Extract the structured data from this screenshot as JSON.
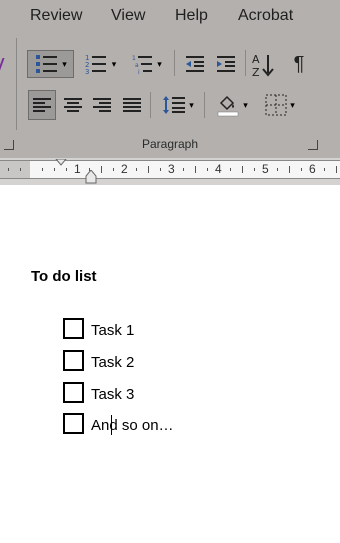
{
  "menu": {
    "items": [
      "Review",
      "View",
      "Help",
      "Acrobat"
    ]
  },
  "ribbon": {
    "group_label": "Paragraph",
    "buttons": {
      "bullets_icon": "bulleted-list-icon",
      "numbering_icon": "numbered-list-icon",
      "multilevel_icon": "multilevel-list-icon",
      "decrease_indent_icon": "decrease-indent-icon",
      "increase_indent_icon": "increase-indent-icon",
      "sort_icon": "sort-az-icon",
      "show_marks_icon": "pilcrow-icon",
      "align_left_icon": "align-left-icon",
      "center_icon": "align-center-icon",
      "align_right_icon": "align-right-icon",
      "justify_icon": "justify-icon",
      "line_spacing_icon": "line-spacing-icon",
      "shading_icon": "paint-bucket-icon",
      "borders_icon": "borders-icon"
    },
    "sort_label": "A Z",
    "pilcrow": "¶"
  },
  "ruler": {
    "numbers": [
      "1",
      "2",
      "3",
      "4",
      "5",
      "6"
    ]
  },
  "document": {
    "title": "To do list",
    "tasks": [
      "Task 1",
      "Task 2",
      "Task 3",
      "And so on…"
    ]
  },
  "colors": {
    "ribbon_bg": "#b3b0ad",
    "page_bg": "#ffffff",
    "active_button": "#9c9a98",
    "accent_blue": "#2b579a"
  }
}
